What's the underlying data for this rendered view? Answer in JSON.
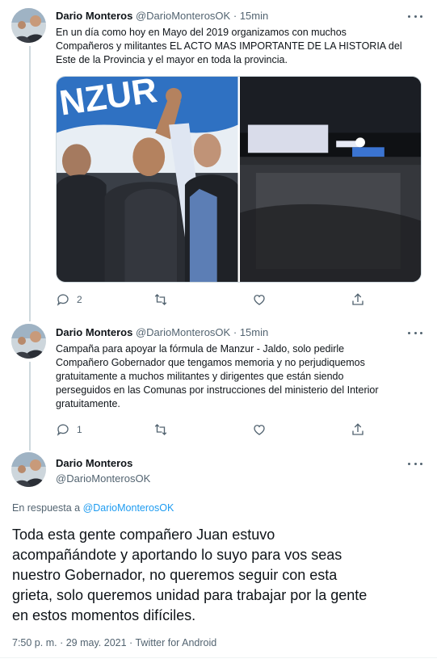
{
  "tweets": [
    {
      "name": "Dario Monteros",
      "handle": "@DarioMonterosOK",
      "separator": "·",
      "time": "15min",
      "text_lines": [
        "En un día como hoy en Mayo del 2019 organizamos con muchos",
        "Compañeros y militantes EL ACTO MAS IMPORTANTE DE LA HISTORIA del",
        "Este de la Provincia y el mayor en toda la provincia."
      ],
      "media_banner_text": "NZUR",
      "replies": "2",
      "retweets": "",
      "likes": "",
      "icons": [
        "reply-icon",
        "retweet-icon",
        "like-icon",
        "share-icon"
      ]
    },
    {
      "name": "Dario Monteros",
      "handle": "@DarioMonterosOK",
      "separator": "·",
      "time": "15min",
      "text_lines": [
        "Campaña para apoyar la fórmula de Manzur - Jaldo, solo pedirle",
        "Compañero Gobernador que tengamos memoria y no perjudiquemos",
        "gratuitamente a muchos militantes y dirigentes que están siendo",
        "perseguidos en las Comunas por instrucciones del ministerio del Interior",
        "gratuitamente."
      ],
      "replies": "1",
      "retweets": "",
      "likes": ""
    }
  ],
  "main_tweet": {
    "name": "Dario Monteros",
    "handle": "@DarioMonterosOK",
    "reply_prefix": "En respuesta a",
    "reply_handle": "@DarioMonterosOK",
    "text_lines": [
      "Toda esta gente compañero Juan estuvo",
      "acompañándote y aportando lo suyo para vos seas",
      "nuestro Gobernador, no queremos seguir con esta",
      "grieta, solo queremos unidad para trabajar por la gente",
      "en estos momentos difíciles."
    ],
    "time": "7:50 p. m.",
    "date": "29 may. 2021",
    "source": "Twitter for Android",
    "separator": "·"
  },
  "colors": {
    "text": "#0f1419",
    "secondary": "#536471",
    "link": "#1d9bf0",
    "thread_line": "#cfd9de"
  }
}
